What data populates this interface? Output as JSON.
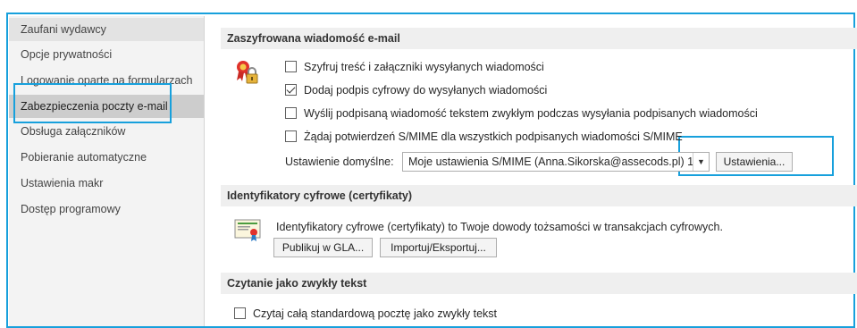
{
  "sidebar": {
    "items": [
      {
        "label": "Zaufani wydawcy"
      },
      {
        "label": "Opcje prywatności"
      },
      {
        "label": "Logowanie oparte na formularzach"
      },
      {
        "label": "Zabezpieczenia poczty e-mail"
      },
      {
        "label": "Obsługa załączników"
      },
      {
        "label": "Pobieranie automatyczne"
      },
      {
        "label": "Ustawienia makr"
      },
      {
        "label": "Dostęp programowy"
      }
    ],
    "selected_index": 3
  },
  "encrypted_section": {
    "title": "Zaszyfrowana wiadomość e-mail",
    "icon": "lock-ribbon-icon",
    "checkboxes": [
      {
        "label": "Szyfruj treść i załączniki wysyłanych wiadomości",
        "checked": false
      },
      {
        "label": "Dodaj podpis cyfrowy do wysyłanych wiadomości",
        "checked": true
      },
      {
        "label": "Wyślij podpisaną wiadomość tekstem zwykłym podczas wysyłania podpisanych wiadomości",
        "checked": false
      },
      {
        "label": "Żądaj potwierdzeń S/MIME dla wszystkich podpisanych wiadomości S/MIME",
        "checked": false
      }
    ],
    "default_setting_label": "Ustawienie domyślne:",
    "default_setting_value": "Moje ustawienia S/MIME (Anna.Sikorska@assecods.pl) 1",
    "settings_button": "Ustawienia..."
  },
  "certificates_section": {
    "title": "Identyfikatory cyfrowe (certyfikaty)",
    "icon": "certificate-icon",
    "description": "Identyfikatory cyfrowe (certyfikaty) to Twoje dowody tożsamości w transakcjach cyfrowych.",
    "publish_button": "Publikuj w GLA...",
    "import_export_button": "Importuj/Eksportuj..."
  },
  "plaintext_section": {
    "title": "Czytanie jako zwykły tekst",
    "checkbox": {
      "label": "Czytaj całą standardową pocztę jako zwykły tekst",
      "checked": false
    }
  },
  "colors": {
    "highlight": "#17a0dc",
    "sidebar_bg": "#f3f3f3",
    "sidebar_selected": "#cdcdcd",
    "section_header_bg": "#efefef"
  }
}
